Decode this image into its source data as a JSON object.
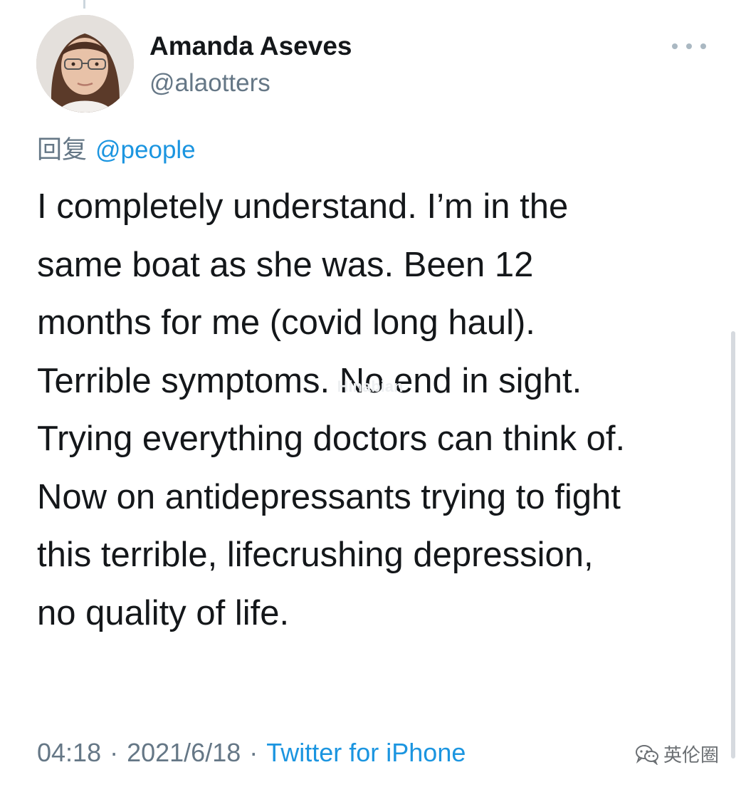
{
  "tweet": {
    "author": {
      "display_name": "Amanda Aseves",
      "handle": "@alaotters",
      "avatar_icon": "user-avatar-photo"
    },
    "more_icon": "more-horizontal-icon",
    "reply": {
      "prefix": "回复",
      "mention": "@people"
    },
    "text_lines": [
      "I completely understand. I’m in the",
      "same boat as she was. Been 12",
      "months for me (covid long haul).",
      "Terrible symptoms. No end in sight.",
      "Trying everything doctors can think of.",
      "Now on antidepressants trying to fight",
      "this terrible, lifecrushing depression,",
      "no quality of life."
    ],
    "meta": {
      "time": "04:18",
      "separator": "·",
      "date": "2021/6/18",
      "source": "Twitter for iPhone"
    }
  },
  "watermarks": {
    "center_brand": "Hinabian",
    "corner_icon": "wechat-icon",
    "corner_text": "英伦圈"
  },
  "colors": {
    "link_blue": "#1b95e0",
    "secondary_gray": "#657786",
    "text_black": "#14171a"
  }
}
